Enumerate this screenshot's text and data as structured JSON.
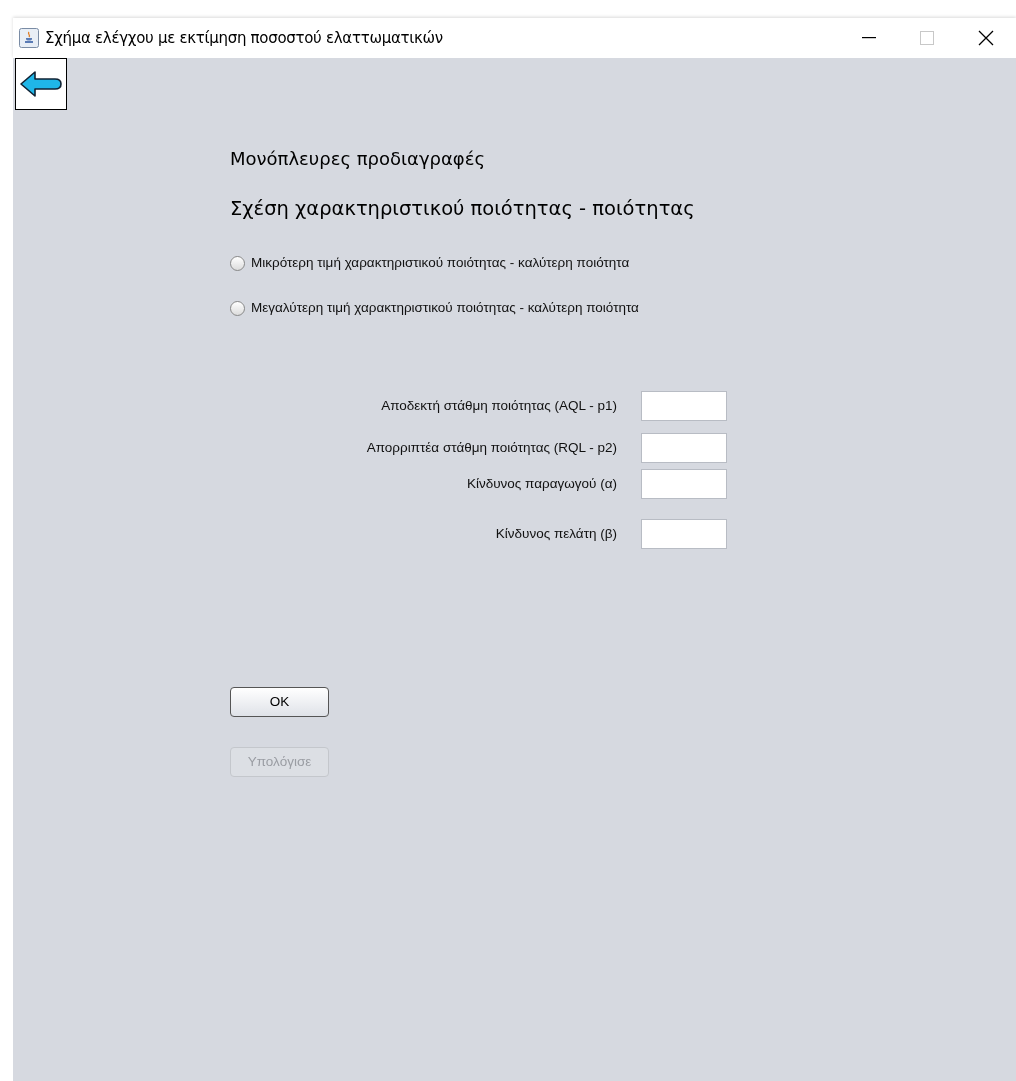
{
  "window": {
    "title": "Σχήμα ελέγχου με εκτίμηση ποσοστού ελαττωματικών"
  },
  "heading": "Μονόπλευρες προδιαγραφές",
  "subheading": "Σχέση χαρακτηριστικού ποιότητας - ποιότητας",
  "options": [
    {
      "label": "Μικρότερη τιμή χαρακτηριστικού ποιότητας - καλύτερη ποιότητα",
      "selected": false
    },
    {
      "label": "Μεγαλύτερη τιμή χαρακτηριστικού ποιότητας - καλύτερη ποιότητα",
      "selected": false
    }
  ],
  "fields": [
    {
      "label": "Αποδεκτή στάθμη ποιότητας (AQL - p1)"
    },
    {
      "label": "Απορριπτέα στάθμη ποιότητας (RQL - p2)"
    },
    {
      "label": "Κίνδυνος παραγωγού (α)"
    },
    {
      "label": "Κίνδυνος πελάτη (β)"
    }
  ],
  "buttons": [
    {
      "label": "OK",
      "disabled": false
    },
    {
      "label": "Υπολόγισε",
      "disabled": true
    }
  ]
}
